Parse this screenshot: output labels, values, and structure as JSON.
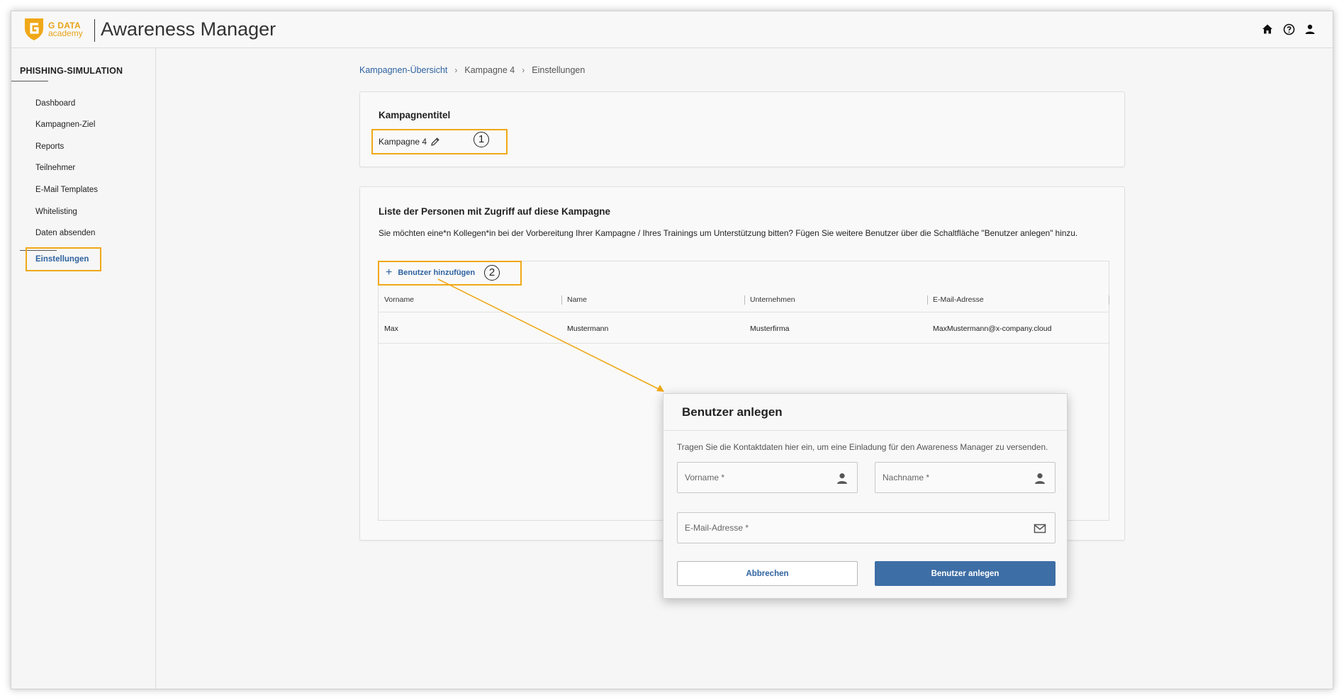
{
  "header": {
    "brand_line1": "G DATA",
    "brand_line2": "academy",
    "app_title": "Awareness Manager",
    "icons": [
      "home-icon",
      "help-icon",
      "user-icon"
    ]
  },
  "sidebar": {
    "section": "PHISHING-SIMULATION",
    "items": [
      {
        "label": "Dashboard"
      },
      {
        "label": "Kampagnen-Ziel"
      },
      {
        "label": "Reports"
      },
      {
        "label": "Teilnehmer"
      },
      {
        "label": "E-Mail Templates"
      },
      {
        "label": "Whitelisting"
      },
      {
        "label": "Daten absenden"
      }
    ],
    "active": "Einstellungen"
  },
  "breadcrumb": {
    "items": [
      "Kampagnen-Übersicht",
      "Kampagne 4",
      "Einstellungen"
    ]
  },
  "campaign": {
    "title_label": "Kampagnentitel",
    "name": "Kampagne 4",
    "callout": "1"
  },
  "access": {
    "title": "Liste der Personen mit Zugriff auf diese Kampagne",
    "description": "Sie möchten eine*n Kollegen*in bei der Vorbereitung Ihrer Kampagne / Ihres Trainings um Unterstützung bitten? Fügen Sie weitere Benutzer über die Schaltfläche \"Benutzer anlegen\" hinzu.",
    "add_button": "Benutzer hinzufügen",
    "callout": "2",
    "columns": [
      "Vorname",
      "Name",
      "Unternehmen",
      "E-Mail-Adresse"
    ],
    "rows": [
      [
        "Max",
        "Mustermann",
        "Musterfirma",
        "MaxMustermann@x-company.cloud"
      ]
    ]
  },
  "modal": {
    "title": "Benutzer anlegen",
    "description": "Tragen Sie die Kontaktdaten hier ein, um eine Einladung für den Awareness Manager zu versenden.",
    "firstname_placeholder": "Vorname *",
    "lastname_placeholder": "Nachname *",
    "email_placeholder": "E-Mail-Adresse *",
    "cancel_label": "Abbrechen",
    "create_label": "Benutzer anlegen"
  },
  "colors": {
    "accent": "#2f63a0",
    "primary_button": "#3d6ea5",
    "highlight": "#f0a818",
    "brand": "#e8a317"
  }
}
